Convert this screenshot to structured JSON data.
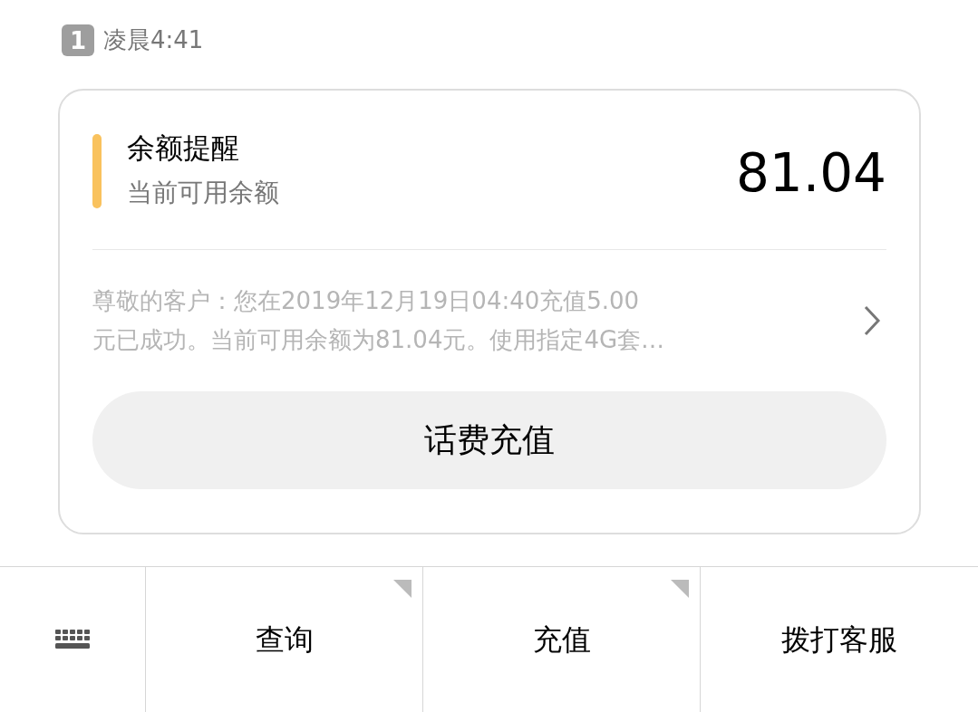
{
  "header": {
    "sim_slot": "1",
    "time": "凌晨4:41"
  },
  "card": {
    "title": "余额提醒",
    "subtitle": "当前可用余额",
    "amount": "81.04",
    "message_lines": [
      "尊敬的客户：您在2019年12月19日04:40充值5.00",
      "元已成功。当前可用余额为81.04元。使用指定4G套…"
    ],
    "button": "话费充值"
  },
  "menu_bar": [
    {
      "kind": "keyboard"
    },
    {
      "kind": "menu",
      "label": "查询",
      "submenu": true
    },
    {
      "kind": "menu",
      "label": "充值",
      "submenu": true
    },
    {
      "kind": "menu",
      "label": "拨打客服",
      "submenu": false
    }
  ]
}
